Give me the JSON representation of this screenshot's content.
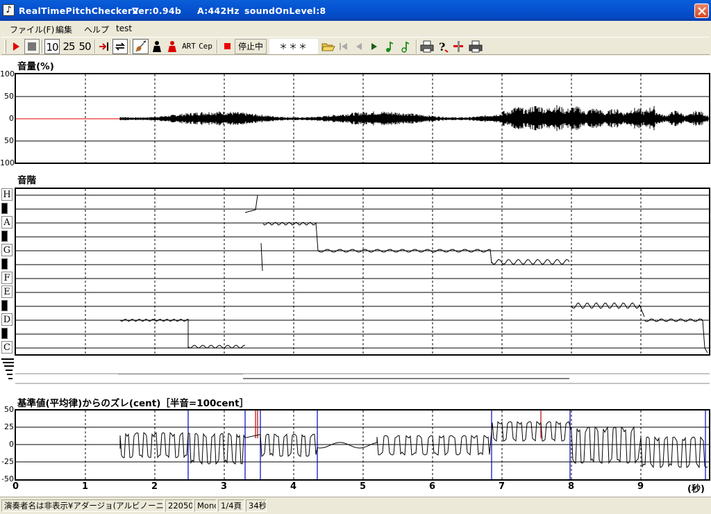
{
  "window": {
    "title": "RealTimePitchChecker2",
    "version": "Ver:0.94b",
    "a_freq": "A:442Hz",
    "sound_on_level": "soundOnLevel:8"
  },
  "menu": [
    "ファイル(F)",
    "編集",
    "ヘルプ",
    "test"
  ],
  "toolbar": {
    "speed_10": "10",
    "speed_25": "25",
    "speed_50": "50",
    "art_label": "ART",
    "cep_label": "Cep",
    "status_text": "停止中",
    "note_display": "＊＊＊"
  },
  "volume_panel": {
    "title": "音量(%)",
    "yticks": [
      "100",
      "50",
      "0",
      "50",
      "100"
    ]
  },
  "pitch_panel": {
    "title": "音階",
    "notes": [
      "H",
      "A",
      "G",
      "F",
      "E",
      "D",
      "C"
    ]
  },
  "cent_panel": {
    "title": "基準値(平均律)からのズレ(cent)［半音=100cent］",
    "yticks": [
      "50",
      "25",
      "0",
      "-25",
      "-50"
    ]
  },
  "time_axis": {
    "ticks": [
      "0",
      "1",
      "2",
      "3",
      "4",
      "5",
      "6",
      "7",
      "8",
      "9"
    ],
    "unit": "(秒)"
  },
  "statusbar": {
    "file": "演奏者名は非表示¥アダージョ(アルビノーニ).wav",
    "rate": "22050",
    "channels": "Mono",
    "page": "1/4頁",
    "duration": "34秒"
  },
  "colors": {
    "title_bar": "#0553d1",
    "close_button": "#d6461e",
    "trace": "#000000",
    "cent_marker": "#0000c0",
    "cent_marker_alt": "#c00000"
  }
}
